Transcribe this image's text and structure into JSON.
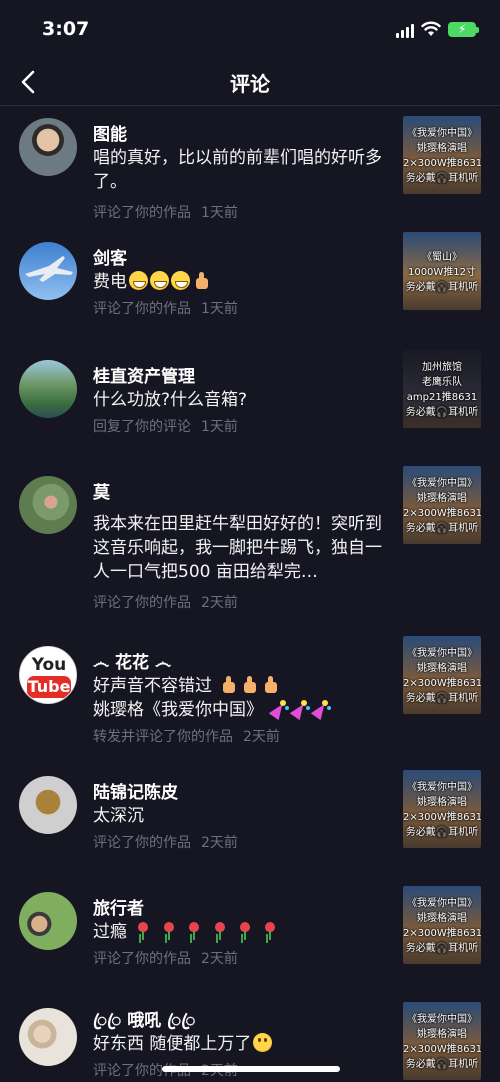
{
  "status_bar": {
    "time": "3:07"
  },
  "nav": {
    "title": "评论"
  },
  "comments": [
    {
      "name": "图能",
      "text": "唱的真好，比以前的前辈们唱的好听多了。",
      "action": "评论了你的作品",
      "time": "1天前",
      "thumb_lines": [
        "《我爱你中国》",
        "姚璎格演唱",
        "2×300W推8631",
        "务必戴🎧耳机听"
      ]
    },
    {
      "name": "剑客",
      "text": "费电",
      "action": "评论了你的作品",
      "time": "1天前",
      "thumb_lines": [
        "《蜀山》",
        "1000W推12寸",
        "务必戴🎧耳机听"
      ]
    },
    {
      "name": "桂直资产管理",
      "text": "什么功放?什么音箱?",
      "action": "回复了你的评论",
      "time": "1天前",
      "thumb_lines": [
        "加州旅馆",
        "老鹰乐队",
        "amp21推8631",
        "务必戴🎧耳机听"
      ]
    },
    {
      "name": "莫",
      "text": "我本来在田里赶牛犁田好好的！突听到这音乐响起，我一脚把牛踢飞，独自一人一口气把500 亩田给犁完…",
      "action": "评论了你的作品",
      "time": "2天前",
      "thumb_lines": [
        "《我爱你中国》",
        "姚璎格演唱",
        "2×300W推8631",
        "务必戴🎧耳机听"
      ]
    },
    {
      "name": "෴ 花花 ෴",
      "text_line1": "好声音不容错过",
      "text_line2": "姚璎格《我爱你中国》",
      "action": "转发并评论了你的作品",
      "time": "2天前",
      "avatar_text": {
        "top": "You",
        "bottom": "Tube"
      },
      "thumb_lines": [
        "《我爱你中国》",
        "姚璎格演唱",
        "2×300W推8631",
        "务必戴🎧耳机听"
      ]
    },
    {
      "name": "陆锦记陈皮",
      "text": "太深沉",
      "action": "评论了你的作品",
      "time": "2天前",
      "thumb_lines": [
        "《我爱你中国》",
        "姚璎格演唱",
        "2×300W推8631",
        "务必戴🎧耳机听"
      ]
    },
    {
      "name": "旅行者",
      "text": "过瘾",
      "action": "评论了你的作品",
      "time": "2天前",
      "thumb_lines": [
        "《我爱你中国》",
        "姚璎格演唱",
        "2×300W推8631",
        "务必戴🎧耳机听"
      ]
    },
    {
      "name": "ꦿꦿ 哦吼 ꦿꦿ",
      "text": "好东西 随便都上万了",
      "action": "评论了你的作品",
      "time": "2天前",
      "thumb_lines": [
        "《我爱你中国》",
        "姚璎格演唱",
        "2×300W推8631",
        "务必戴🎧耳机听"
      ]
    }
  ],
  "colors": {
    "background": "#161622",
    "meta_text": "#6f6f7d",
    "battery": "#4cd964"
  },
  "icons": [
    "back-chevron-icon",
    "cellular-signal-icon",
    "wifi-icon",
    "battery-charging-icon"
  ]
}
